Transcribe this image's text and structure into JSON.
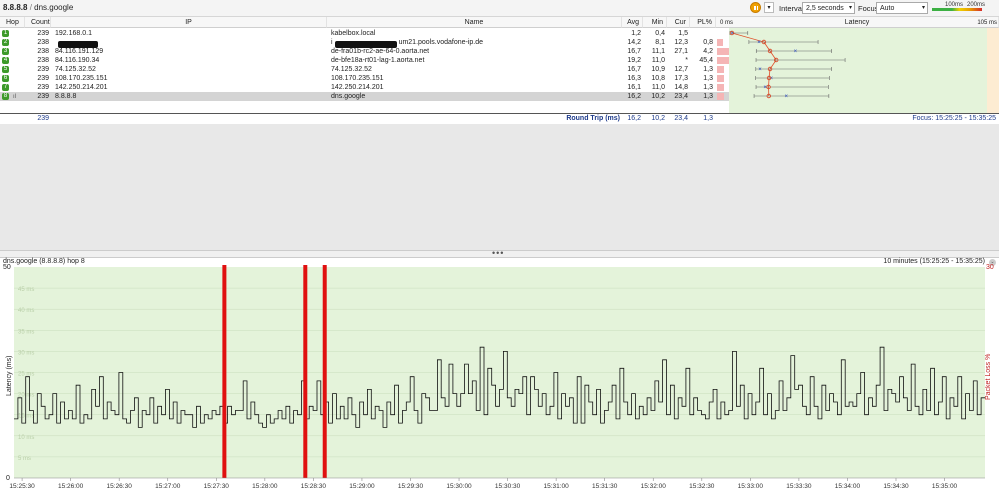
{
  "toolbar": {
    "title_target": "8.8.8.8",
    "title_sep": " / ",
    "title_host": "dns.google",
    "interval_label": "Interval",
    "interval_value": "2,5 seconds",
    "focus_label": "Focus",
    "focus_value": "Auto",
    "scale_100": "100ms",
    "scale_200": "200ms",
    "icons": [
      "pause-icon",
      "chevron-down-icon"
    ]
  },
  "table": {
    "columns": {
      "hop": "Hop",
      "count": "Count",
      "ip": "IP",
      "name": "Name",
      "avg": "Avg",
      "min": "Min",
      "cur": "Cur",
      "pl": "PL%",
      "latency": "Latency"
    },
    "latency_scale_start": "0 ms",
    "latency_scale_end": "105 ms",
    "rows": [
      {
        "hop": "1",
        "count": "239",
        "ip": "192.168.0.1",
        "name": "kabelbox.local",
        "avg": "1,2",
        "min": "0,4",
        "cur": "1,5",
        "pl": "",
        "pl_value": 0
      },
      {
        "hop": "2",
        "count": "238",
        "ip": "",
        "name": "i",
        "name_suffix": "um21.pools.vodafone-ip.de",
        "avg": "14,2",
        "min": "8,1",
        "cur": "12,3",
        "pl": "0,8",
        "pl_value": 0.8
      },
      {
        "hop": "3",
        "count": "238",
        "ip": "84.116.191.129",
        "name": "de-fra01b-rc2-ae-64-0.aorta.net",
        "avg": "16,7",
        "min": "11,1",
        "cur": "27,1",
        "pl": "4,2",
        "pl_value": 4.2
      },
      {
        "hop": "4",
        "count": "238",
        "ip": "84.116.190.34",
        "name": "de-bfe18a-rt01-lag-1.aorta.net",
        "avg": "19,2",
        "min": "11,0",
        "cur": "*",
        "pl": "45,4",
        "pl_value": 45.4
      },
      {
        "hop": "5",
        "count": "239",
        "ip": "74.125.32.52",
        "name": "74.125.32.52",
        "avg": "16,7",
        "min": "10,9",
        "cur": "12,7",
        "pl": "1,3",
        "pl_value": 1.3
      },
      {
        "hop": "6",
        "count": "239",
        "ip": "108.170.235.151",
        "name": "108.170.235.151",
        "avg": "16,3",
        "min": "10,8",
        "cur": "17,3",
        "pl": "1,3",
        "pl_value": 1.3
      },
      {
        "hop": "7",
        "count": "239",
        "ip": "142.250.214.201",
        "name": "142.250.214.201",
        "avg": "16,1",
        "min": "11,0",
        "cur": "14,8",
        "pl": "1,3",
        "pl_value": 1.3
      },
      {
        "hop": "8",
        "count": "239",
        "ip": "8.8.8.8",
        "name": "dns.google",
        "avg": "16,2",
        "min": "10,2",
        "cur": "23,4",
        "pl": "1,3",
        "pl_value": 1.3
      }
    ],
    "summary": {
      "count": "239",
      "label": "Round Trip (ms)",
      "avg": "16,2",
      "min": "10,2",
      "cur": "23,4",
      "pl": "1,3",
      "focus": "Focus: 15:25:25 - 15:35:25"
    }
  },
  "graph": {
    "title": "dns.google (8.8.8.8) hop 8",
    "range": "10 minutes (15:25:25 - 15:35:25)",
    "y_left_title": "Latency (ms)",
    "y_right_title": "Packet Loss %",
    "y_left_ticks": [
      "50",
      "0"
    ],
    "y_right_ticks": [
      "30"
    ],
    "y_gridlines": [
      "45 ms",
      "40 ms",
      "35 ms",
      "30 ms",
      "25 ms",
      "20 ms",
      "15 ms",
      "10 ms",
      "5 ms"
    ],
    "x_ticks": [
      "15:25:30",
      "15:26:00",
      "15:26:30",
      "15:27:00",
      "15:27:30",
      "15:28:00",
      "15:28:30",
      "15:29:00",
      "15:29:30",
      "15:30:00",
      "15:30:30",
      "15:31:00",
      "15:31:30",
      "15:32:00",
      "15:32:30",
      "15:33:00",
      "15:33:30",
      "15:34:00",
      "15:34:30",
      "15:35:00"
    ],
    "colors": {
      "bg": "#e4f3da",
      "line": "#111111",
      "loss": "#e01010",
      "grid": "#c9dcbc"
    }
  },
  "chart_data": {
    "type": "line",
    "title": "dns.google (8.8.8.8) hop 8",
    "xlabel": "",
    "ylabel": "Latency (ms)",
    "ylim": [
      0,
      50
    ],
    "x_range": [
      "15:25:25",
      "15:35:25"
    ],
    "x_interval": "2,5 seconds",
    "latency_series": [
      {
        "name": "Latency (ms)",
        "values": [
          14,
          19,
          13,
          24,
          16,
          13,
          20,
          17,
          14,
          15,
          20,
          13,
          18,
          14,
          16,
          14,
          22,
          13,
          15,
          14,
          21,
          17,
          24,
          14,
          18,
          16,
          15,
          25,
          14,
          13,
          16,
          19,
          12,
          16,
          15,
          19,
          13,
          17,
          15,
          21,
          14,
          18,
          13,
          16,
          15,
          15,
          12,
          17,
          13,
          15,
          14,
          16,
          15,
          17,
          13,
          17,
          15,
          16,
          16,
          23,
          14,
          18,
          15,
          13,
          12,
          15,
          13,
          14,
          16,
          14,
          17,
          13,
          16,
          15,
          23,
          14,
          17,
          16,
          23,
          15,
          18,
          13,
          20,
          14,
          17,
          14,
          19,
          15,
          12,
          18,
          15,
          21,
          14,
          17,
          16,
          12,
          18,
          15,
          22,
          13,
          16,
          18,
          24,
          16,
          13,
          20,
          19,
          16,
          16,
          28,
          19,
          17,
          27,
          20,
          17,
          20,
          27,
          20,
          23,
          16,
          31,
          15,
          26,
          22,
          17,
          21,
          30,
          19,
          17,
          21,
          20,
          24,
          15,
          24,
          21,
          17,
          20,
          15,
          17,
          25,
          14,
          20,
          17,
          19,
          13,
          24,
          13,
          22,
          18,
          15,
          21,
          13,
          16,
          18,
          22,
          14,
          26,
          18,
          15,
          20,
          14,
          17,
          15,
          19,
          16,
          23,
          18,
          28,
          15,
          22,
          14,
          19,
          17,
          26,
          15,
          19,
          16,
          15,
          14,
          18,
          21,
          14,
          18,
          15,
          16,
          30,
          17,
          22,
          14,
          20,
          15,
          18,
          26,
          15,
          20,
          14,
          16,
          23,
          16,
          19,
          29,
          21,
          22,
          17,
          15,
          24,
          17,
          14,
          22,
          16,
          20,
          18,
          15,
          28,
          17,
          18,
          17,
          20,
          25,
          15,
          19,
          17,
          22,
          31,
          16,
          21,
          20,
          18,
          24,
          19,
          16,
          27,
          17,
          15,
          21,
          16,
          26,
          15,
          18,
          24,
          14,
          19,
          17,
          24,
          14,
          20,
          16,
          23,
          15,
          19
        ]
      }
    ],
    "packet_loss_times": [
      "15:27:35",
      "15:28:25",
      "15:28:37"
    ]
  }
}
